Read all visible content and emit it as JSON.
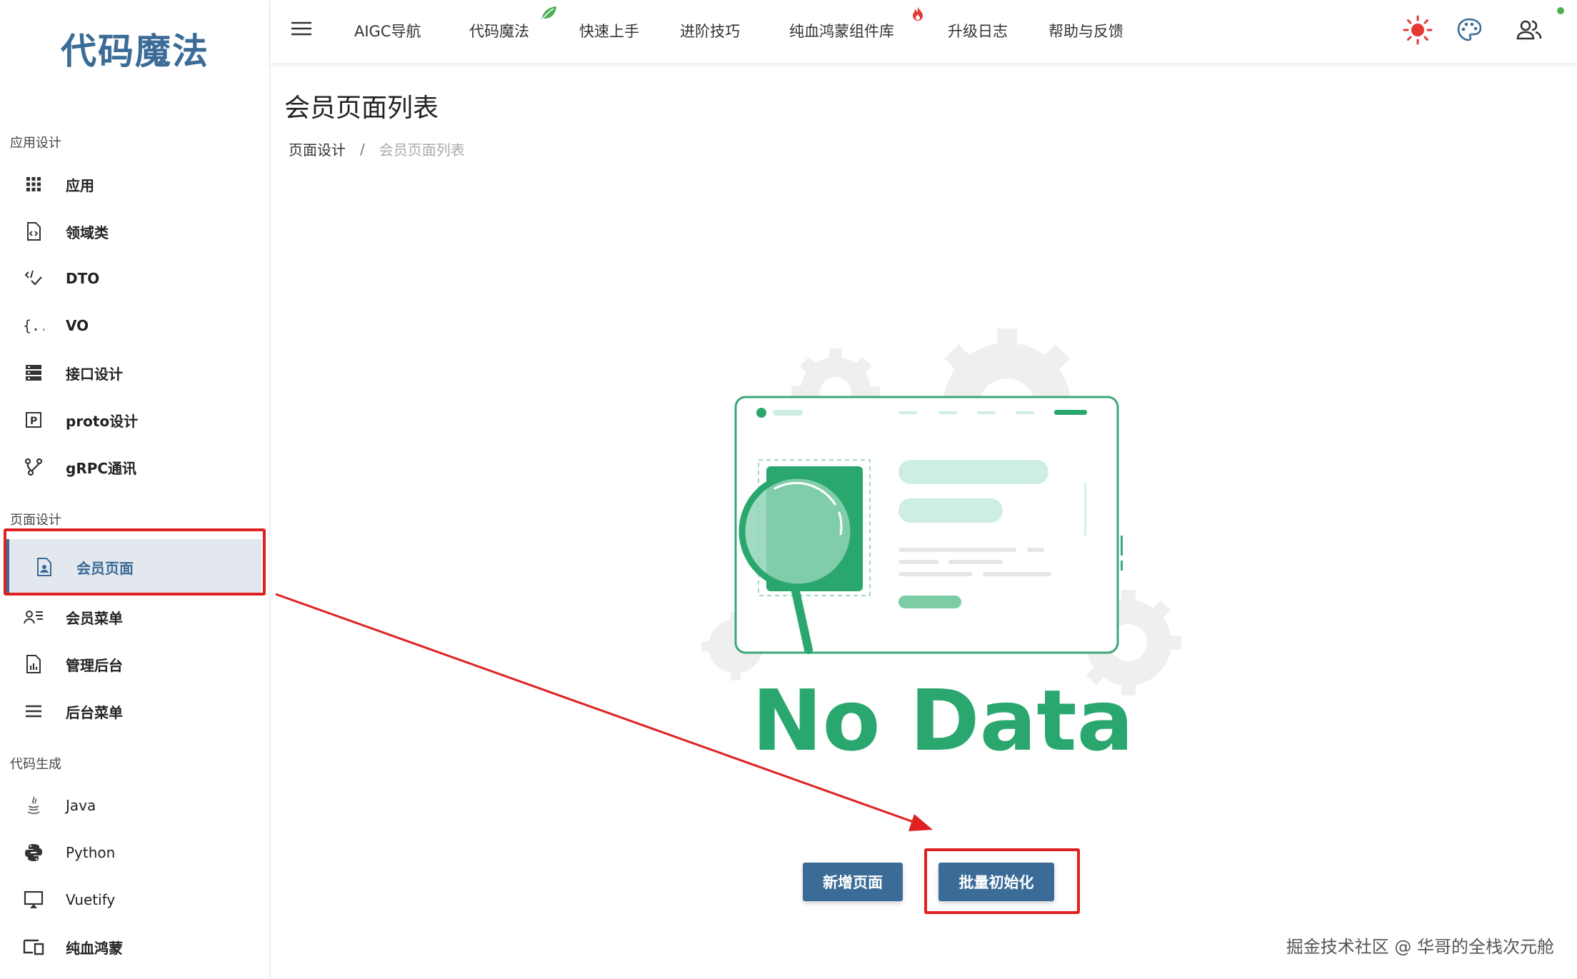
{
  "app": {
    "logo": "代码魔法"
  },
  "sidebar": {
    "sections": [
      {
        "title": "应用设计"
      },
      {
        "title": "页面设计"
      },
      {
        "title": "代码生成"
      }
    ],
    "items": [
      {
        "label": "应用",
        "icon": "grid-icon"
      },
      {
        "label": "领域类",
        "icon": "code-file-icon"
      },
      {
        "label": "DTO",
        "icon": "transfer-icon"
      },
      {
        "label": "VO",
        "icon": "braces-icon"
      },
      {
        "label": "接口设计",
        "icon": "server-icon"
      },
      {
        "label": "proto设计",
        "icon": "p-box-icon"
      },
      {
        "label": "gRPC通讯",
        "icon": "branch-icon"
      },
      {
        "label": "会员页面",
        "icon": "account-file-icon"
      },
      {
        "label": "会员菜单",
        "icon": "account-list-icon"
      },
      {
        "label": "管理后台",
        "icon": "chart-file-icon"
      },
      {
        "label": "后台菜单",
        "icon": "menu-icon"
      },
      {
        "label": "Java",
        "icon": "java-icon"
      },
      {
        "label": "Python",
        "icon": "python-icon"
      },
      {
        "label": "Vuetify",
        "icon": "monitor-icon"
      },
      {
        "label": "纯血鸿蒙",
        "icon": "devices-icon"
      }
    ],
    "active_item": "会员页面"
  },
  "topbar": {
    "links": [
      {
        "label": "AIGC导航"
      },
      {
        "label": "代码魔法",
        "badge": "leaf-icon"
      },
      {
        "label": "快速上手"
      },
      {
        "label": "进阶技巧"
      },
      {
        "label": "纯血鸿蒙组件库",
        "badge": "fire-icon"
      },
      {
        "label": "升级日志"
      },
      {
        "label": "帮助与反馈"
      }
    ],
    "right_icons": [
      "sun-icon",
      "palette-icon",
      "account-group-icon"
    ],
    "online_dot_color": "#4caf50"
  },
  "main": {
    "title": "会员页面列表",
    "breadcrumb": {
      "parent": "页面设计",
      "separator": "/",
      "current": "会员页面列表"
    },
    "empty_state_text": "No Data",
    "buttons": {
      "add_page": "新增页面",
      "batch_init": "批量初始化"
    }
  },
  "watermark": "掘金技术社区 @ 华哥的全栈次元舱",
  "colors": {
    "brand": "#3b6c97",
    "active_bg": "#e3e8ee",
    "highlight_red": "#e02020",
    "illustration_green": "#2aa76e"
  }
}
